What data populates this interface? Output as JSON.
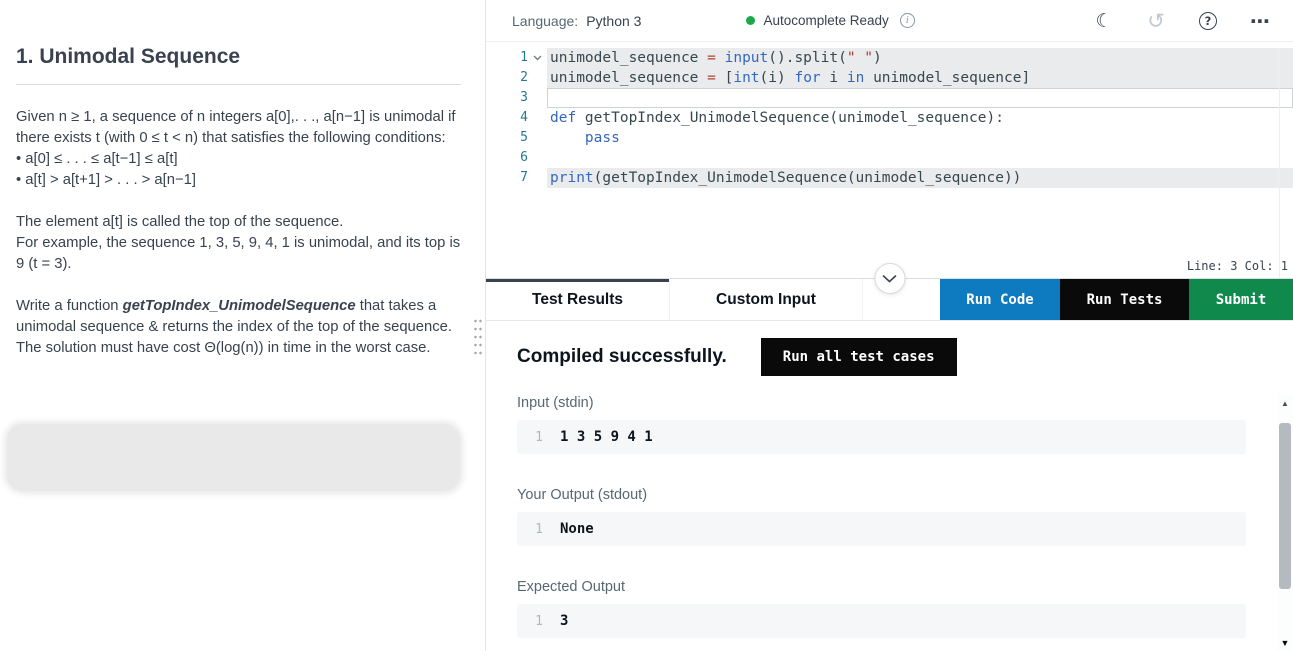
{
  "colors": {
    "run_code": "#0e7abf",
    "run_tests": "#0a0a0a",
    "submit": "#0f8a4c",
    "autocomplete_dot": "#1ba94c",
    "tab_active_accent": "#39424e",
    "code_keyword": "#3567c0",
    "code_string": "#b0392e",
    "code_operator": "#b0453a",
    "code_plain": "#37474f"
  },
  "left": {
    "title": "1. Unimodal Sequence",
    "intro": "Given n ≥ 1, a sequence of n integers a[0],. . ., a[n−1] is unimodal if there exists t (with 0 ≤ t < n) that satisfies the following conditions:",
    "bullet1": "• a[0] ≤ . . . ≤ a[t−1] ≤ a[t]",
    "bullet2": "• a[t] > a[t+1] > . . . > a[n−1]",
    "top_def": "The element a[t] is called the top of the sequence.",
    "example": "For example, the sequence 1, 3, 5, 9, 4, 1 is unimodal, and its top is 9 (t = 3).",
    "task_before": "Write a function ",
    "task_func": "getTopIndex_UnimodelSequence",
    "task_after": " that takes a unimodal sequence & returns the index of the top of the sequence. The solution must have cost Θ(log(n)) in time in the worst case."
  },
  "toolbar": {
    "language_label": "Language:",
    "language_value": "Python 3",
    "autocomplete_status": "Autocomplete Ready"
  },
  "icons": {
    "info": "i",
    "dark_mode": "☾",
    "history": "↺",
    "help": "?",
    "more": "⋯",
    "scroll_up": "▲",
    "scroll_down": "▼"
  },
  "editor": {
    "status": "Line: 3 Col: 1",
    "lines": [
      {
        "no": "1",
        "fold": true,
        "hl": "bg",
        "tokens": [
          {
            "c": "plain",
            "t": "unimodel_sequence "
          },
          {
            "c": "op",
            "t": "= "
          },
          {
            "c": "kw",
            "t": "input"
          },
          {
            "c": "plain",
            "t": "().split("
          },
          {
            "c": "str",
            "t": "\" \""
          },
          {
            "c": "plain",
            "t": ")"
          }
        ]
      },
      {
        "no": "2",
        "hl": "bg",
        "tokens": [
          {
            "c": "plain",
            "t": "unimodel_sequence "
          },
          {
            "c": "op",
            "t": "= "
          },
          {
            "c": "plain",
            "t": "["
          },
          {
            "c": "kw",
            "t": "int"
          },
          {
            "c": "plain",
            "t": "(i) "
          },
          {
            "c": "kw",
            "t": "for"
          },
          {
            "c": "plain",
            "t": " i "
          },
          {
            "c": "kw",
            "t": "in"
          },
          {
            "c": "plain",
            "t": " unimodel_sequence]"
          }
        ]
      },
      {
        "no": "3",
        "hl": "cursor",
        "tokens": []
      },
      {
        "no": "4",
        "tokens": [
          {
            "c": "kw",
            "t": "def"
          },
          {
            "c": "plain",
            "t": " getTopIndex_UnimodelSequence(unimodel_sequence):"
          }
        ]
      },
      {
        "no": "5",
        "tokens": [
          {
            "c": "plain",
            "t": "    "
          },
          {
            "c": "kw",
            "t": "pass"
          }
        ]
      },
      {
        "no": "6",
        "tokens": []
      },
      {
        "no": "7",
        "hl": "bg",
        "tokens": [
          {
            "c": "kw",
            "t": "print"
          },
          {
            "c": "plain",
            "t": "(getTopIndex_UnimodelSequence(unimodel_sequence))"
          }
        ]
      }
    ]
  },
  "tabs": {
    "test_results": "Test Results",
    "custom_input": "Custom Input"
  },
  "actions": {
    "run_code": "Run Code",
    "run_tests": "Run Tests",
    "submit": "Submit",
    "run_all": "Run all test cases"
  },
  "results": {
    "compile_status": "Compiled successfully.",
    "sections": [
      {
        "label": "Input (stdin)",
        "line_no": "1",
        "content": "1 3 5 9 4 1"
      },
      {
        "label": "Your Output (stdout)",
        "line_no": "1",
        "content": "None"
      },
      {
        "label": "Expected Output",
        "line_no": "1",
        "content": "3"
      }
    ]
  }
}
